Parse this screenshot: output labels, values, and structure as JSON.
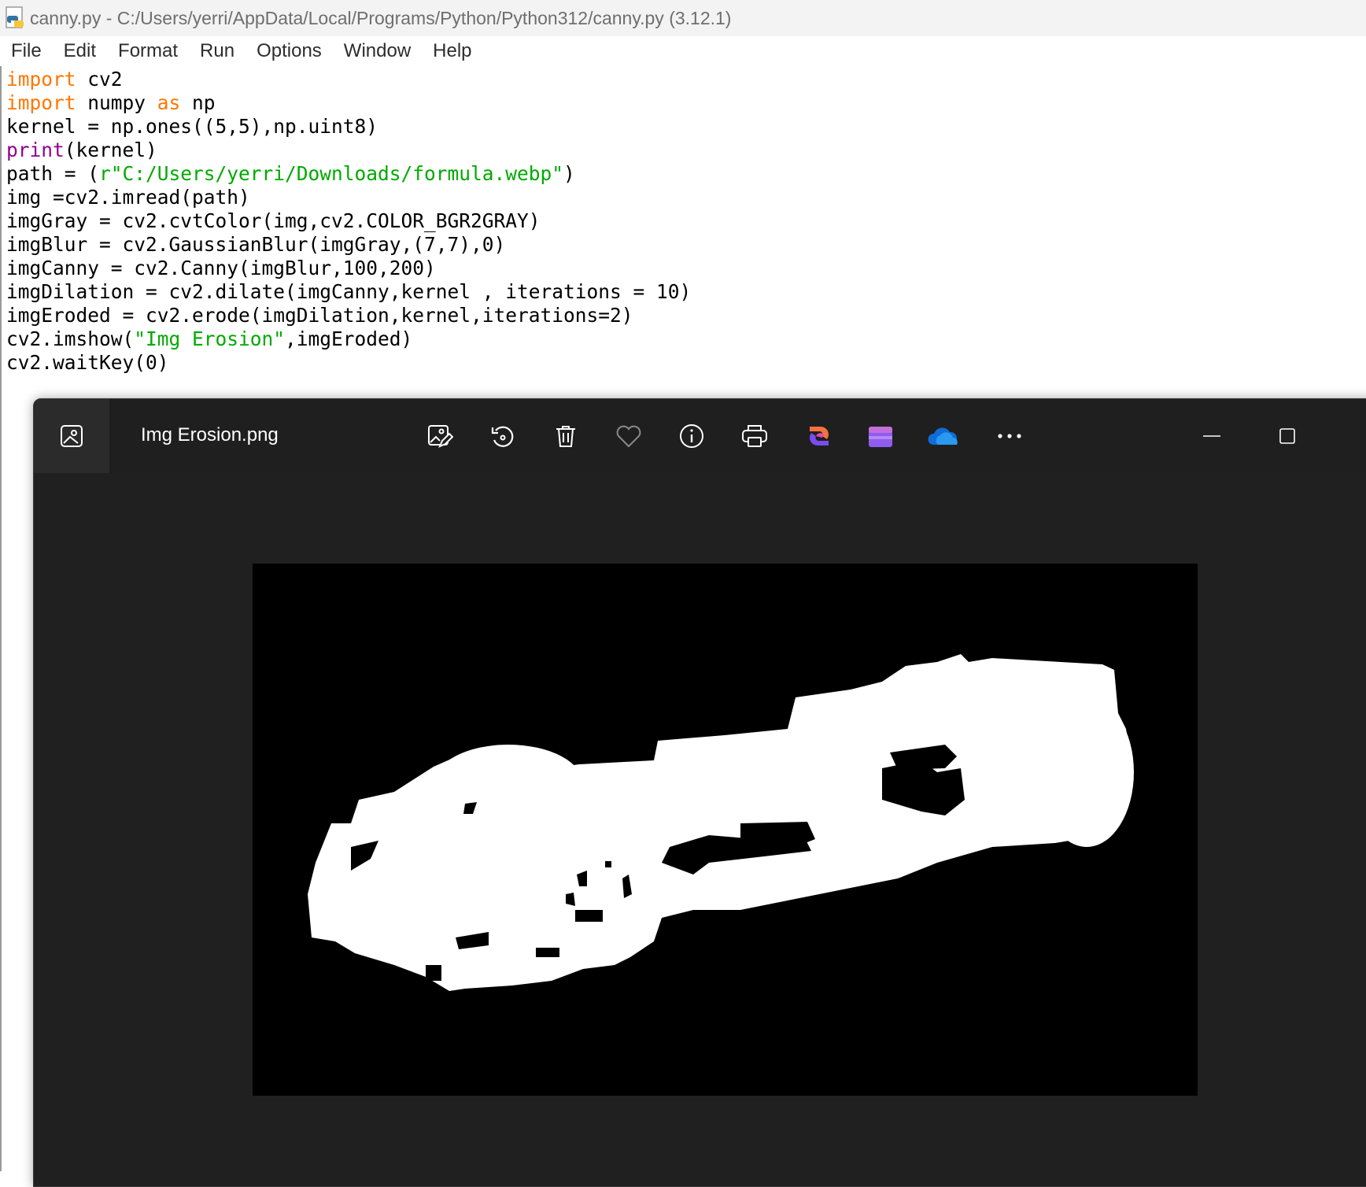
{
  "idle": {
    "title": "canny.py - C:/Users/yerri/AppData/Local/Programs/Python/Python312/canny.py (3.12.1)",
    "menu": [
      "File",
      "Edit",
      "Format",
      "Run",
      "Options",
      "Window",
      "Help"
    ],
    "code_lines": [
      [
        {
          "t": "import",
          "c": "kw"
        },
        {
          "t": " cv2",
          "c": ""
        }
      ],
      [
        {
          "t": "import",
          "c": "kw"
        },
        {
          "t": " numpy ",
          "c": ""
        },
        {
          "t": "as",
          "c": "kw"
        },
        {
          "t": " np",
          "c": ""
        }
      ],
      [
        {
          "t": "kernel = np.ones((5,5),np.uint8)",
          "c": ""
        }
      ],
      [
        {
          "t": "print",
          "c": "bi"
        },
        {
          "t": "(kernel)",
          "c": ""
        }
      ],
      [
        {
          "t": "path = (",
          "c": ""
        },
        {
          "t": "r\"C:/Users/yerri/Downloads/formula.webp\"",
          "c": "st"
        },
        {
          "t": ")",
          "c": ""
        }
      ],
      [
        {
          "t": "img =cv2.imread(path)",
          "c": ""
        }
      ],
      [
        {
          "t": "imgGray = cv2.cvtColor(img,cv2.COLOR_BGR2GRAY)",
          "c": ""
        }
      ],
      [
        {
          "t": "imgBlur = cv2.GaussianBlur(imgGray,(7,7),0)",
          "c": ""
        }
      ],
      [
        {
          "t": "imgCanny = cv2.Canny(imgBlur,100,200)",
          "c": ""
        }
      ],
      [
        {
          "t": "imgDilation = cv2.dilate(imgCanny,kernel , iterations = 10)",
          "c": ""
        }
      ],
      [
        {
          "t": "imgEroded = cv2.erode(imgDilation,kernel,iterations=2)",
          "c": ""
        }
      ],
      [
        {
          "t": "cv2.imshow(",
          "c": ""
        },
        {
          "t": "\"Img Erosion\"",
          "c": "st"
        },
        {
          "t": ",imgEroded)",
          "c": ""
        }
      ],
      [
        {
          "t": "cv2.waitKey(0)",
          "c": ""
        }
      ]
    ]
  },
  "photos": {
    "file_name": "Img Erosion.png",
    "toolbar_icons": [
      "edit-image-icon",
      "rotate-icon",
      "delete-icon",
      "favorite-icon",
      "info-icon",
      "print-icon",
      "copilot-icon",
      "clipchamp-icon",
      "onedrive-icon",
      "more-icon"
    ],
    "window_controls": [
      "minimize-icon",
      "maximize-icon"
    ]
  },
  "colors": {
    "keyword": "#ff7700",
    "builtin": "#900090",
    "string": "#00aa00",
    "viewer_bg": "#202020"
  }
}
